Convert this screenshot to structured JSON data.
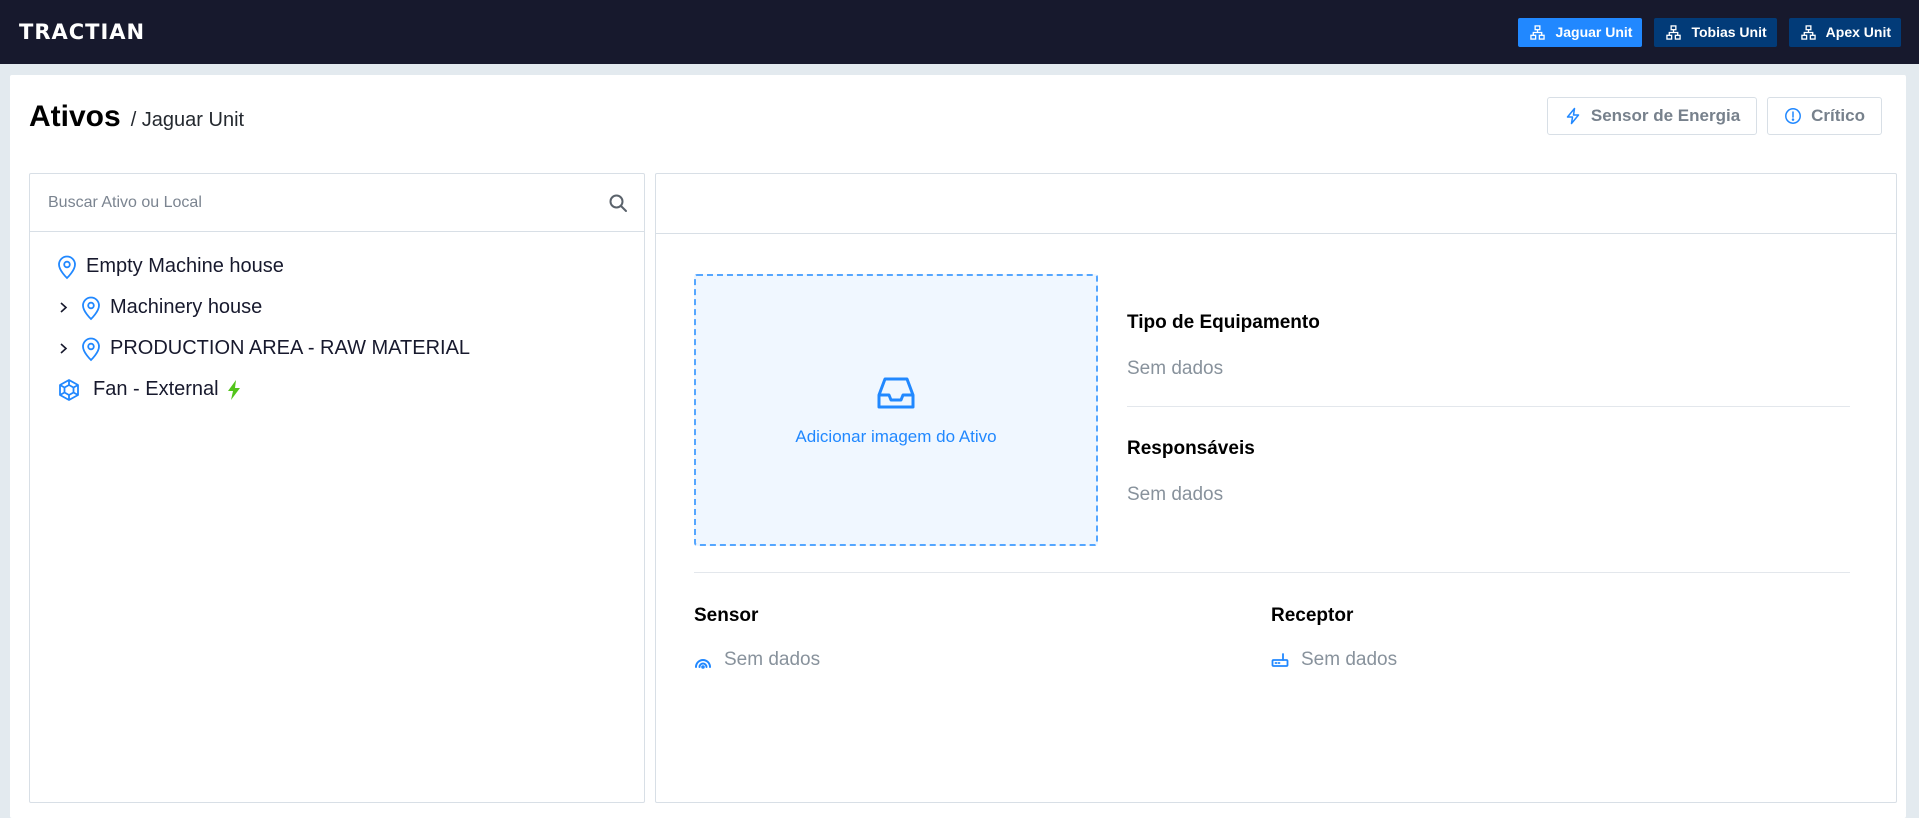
{
  "header": {
    "logo": "TRACTIAN",
    "units": [
      {
        "label": "Jaguar Unit",
        "active": true
      },
      {
        "label": "Tobias Unit",
        "active": false
      },
      {
        "label": "Apex Unit",
        "active": false
      }
    ]
  },
  "page": {
    "title": "Ativos",
    "breadcrumb": "/ Jaguar Unit",
    "filters": {
      "energy_label": "Sensor de Energia",
      "critical_label": "Crítico"
    }
  },
  "tree": {
    "search_placeholder": "Buscar Ativo ou Local",
    "nodes": [
      {
        "label": "Empty Machine house",
        "type": "location",
        "expandable": false
      },
      {
        "label": "Machinery house",
        "type": "location",
        "expandable": true
      },
      {
        "label": "PRODUCTION AREA - RAW MATERIAL",
        "type": "location",
        "expandable": true
      },
      {
        "label": "Fan - External",
        "type": "component",
        "status": "energy"
      }
    ]
  },
  "details": {
    "image_upload_label": "Adicionar imagem do Ativo",
    "equipment_type_title": "Tipo de Equipamento",
    "equipment_type_value": "Sem dados",
    "responsible_title": "Responsáveis",
    "responsible_value": "Sem dados",
    "sensor_title": "Sensor",
    "sensor_value": "Sem dados",
    "receiver_title": "Receptor",
    "receiver_value": "Sem dados"
  },
  "colors": {
    "header_bg": "#17192d",
    "accent": "#2188ff",
    "unit_inactive": "#023b78",
    "energy_green": "#52c41a"
  },
  "icons": {
    "unit": "unit-tree-icon",
    "energy": "bolt-icon",
    "critical": "info-circle-icon",
    "search": "search-icon",
    "location": "location-pin-icon",
    "component": "component-icon",
    "upload": "inbox-icon",
    "sensor": "wifi-signal-icon",
    "receiver": "router-icon"
  }
}
